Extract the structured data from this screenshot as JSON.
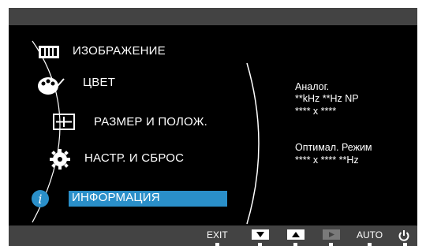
{
  "menu": {
    "items": [
      {
        "label": "ИЗОБРАЖЕНИЕ",
        "icon": "picture-icon"
      },
      {
        "label": "ЦВЕТ",
        "icon": "palette-icon"
      },
      {
        "label": "РАЗМЕР И ПОЛОЖ.",
        "icon": "size-position-icon"
      },
      {
        "label": "НАСТР. И СБРОС",
        "icon": "gear-icon"
      },
      {
        "label": "ИНФОРМАЦИЯ",
        "icon": "info-icon",
        "selected": true
      }
    ]
  },
  "info_panel": {
    "signal_type": "Аналог.",
    "frequency": "**kHz **Hz NP",
    "resolution": "**** x ****",
    "optimal_label": "Оптимал. Режим",
    "optimal_value": "**** x ****  **Hz"
  },
  "bottom_bar": {
    "exit_label": "EXIT",
    "auto_label": "AUTO",
    "buttons": [
      "down-arrow-button",
      "up-arrow-button",
      "right-arrow-button",
      "power-button"
    ]
  },
  "colors": {
    "selection": "#2a8fc9",
    "bar": "#434343",
    "background": "#000000"
  }
}
